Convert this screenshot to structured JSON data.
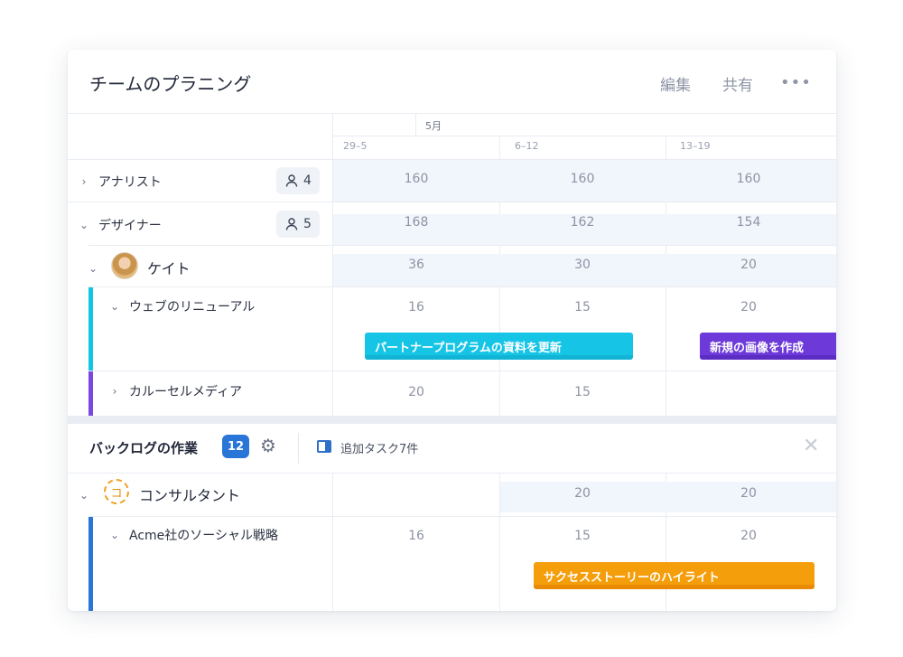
{
  "header": {
    "title": "チームのプラニング",
    "edit_label": "編集",
    "share_label": "共有",
    "more_label": "•••"
  },
  "timeline": {
    "month": "5月",
    "weeks": [
      "29–5",
      "6–12",
      "13–19"
    ]
  },
  "rows": {
    "analyst": {
      "label": "アナリスト",
      "count": "4",
      "values": [
        "160",
        "160",
        "160"
      ]
    },
    "designer": {
      "label": "デザイナー",
      "count": "5",
      "values": [
        "168",
        "162",
        "154"
      ]
    },
    "kate": {
      "label": "ケイト",
      "values": [
        "36",
        "30",
        "20"
      ]
    },
    "web_renewal": {
      "label": "ウェブのリニューアル",
      "values": [
        "16",
        "15",
        "20"
      ],
      "accent_color": "#12c6e3",
      "bars": [
        {
          "label": "パートナープログラムの資料を更新",
          "color": "#16c5e6"
        },
        {
          "label": "新規の画像を作成",
          "color": "#6d3ad9"
        }
      ]
    },
    "carousel": {
      "label": "カルーセルメディア",
      "values": [
        "20",
        "15",
        ""
      ],
      "accent_color": "#7b47e0"
    }
  },
  "backlog": {
    "title": "バックログの作業",
    "count": "12",
    "add_tasks_label": "追加タスク7件",
    "close_label": "✕"
  },
  "backlog_rows": {
    "consultant": {
      "label": "コンサルタント",
      "icon_letter": "コ",
      "values": [
        "",
        "20",
        "20"
      ]
    },
    "acme": {
      "label": "Acme社のソーシャル戦略",
      "values": [
        "16",
        "15",
        "20"
      ],
      "accent_color": "#2a76d8",
      "bar": {
        "label": "サクセスストーリーのハイライト",
        "color": "#f59e0b"
      }
    }
  },
  "icons": {
    "person": "person-icon",
    "gear": "gear-icon",
    "panel": "panel-icon",
    "close": "close-icon",
    "chevron_right": "chevron-right-icon",
    "chevron_down": "chevron-down-icon"
  }
}
